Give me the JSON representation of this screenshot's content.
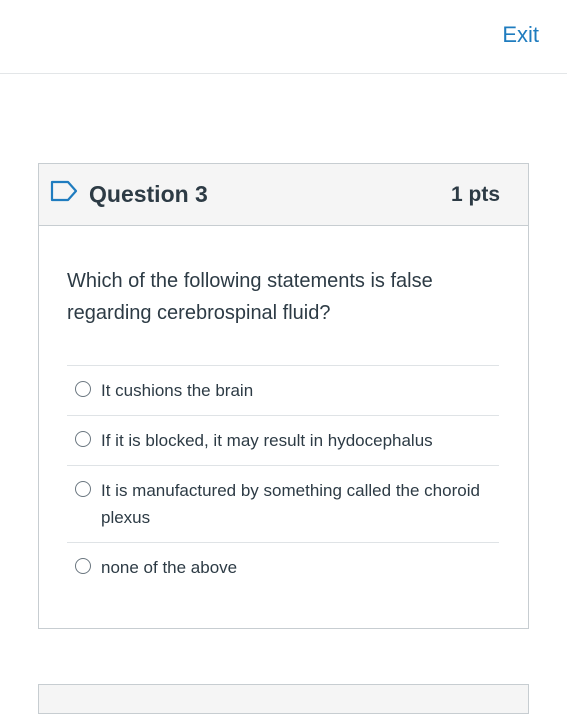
{
  "header": {
    "exit_label": "Exit"
  },
  "question": {
    "title": "Question 3",
    "points": "1 pts",
    "text": "Which of the following statements is false regarding cerebrospinal fluid?",
    "answers": [
      {
        "label": "It cushions the brain"
      },
      {
        "label": "If it is blocked, it may result in hydocephalus"
      },
      {
        "label": "It is manufactured by something called the choroid plexus"
      },
      {
        "label": "none of the above"
      }
    ]
  },
  "icons": {
    "flag": "bookmark-flag-icon"
  },
  "colors": {
    "link": "#1f7cbf",
    "text": "#2d3b45",
    "header_bg": "#f5f5f5",
    "border": "#c7cdd1"
  }
}
